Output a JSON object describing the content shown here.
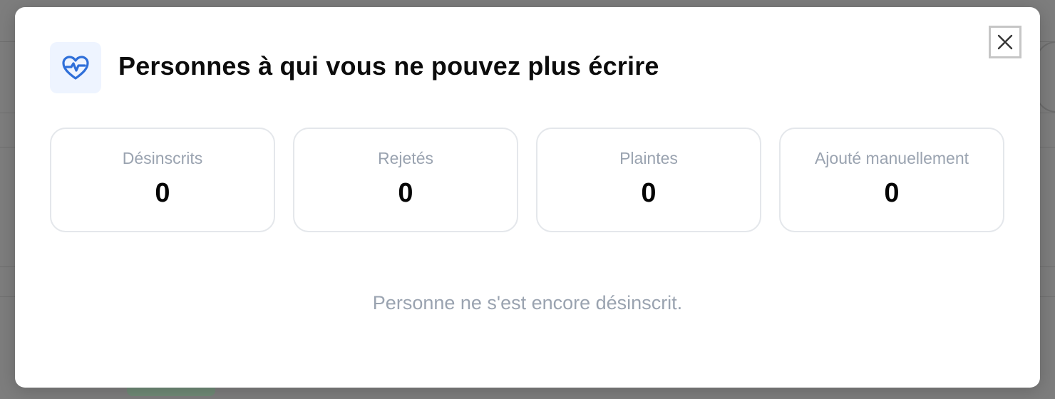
{
  "modal": {
    "title": "Personnes à qui vous ne pouvez plus écrire",
    "header_icon": "heart-pulse-icon",
    "close_icon": "close-icon",
    "accent_color": "#2f6fd9",
    "stats": [
      {
        "label": "Désinscrits",
        "value": "0"
      },
      {
        "label": "Rejetés",
        "value": "0"
      },
      {
        "label": "Plaintes",
        "value": "0"
      },
      {
        "label": "Ajouté manuellement",
        "value": "0"
      }
    ],
    "empty_message": "Personne ne s'est encore désinscrit."
  }
}
